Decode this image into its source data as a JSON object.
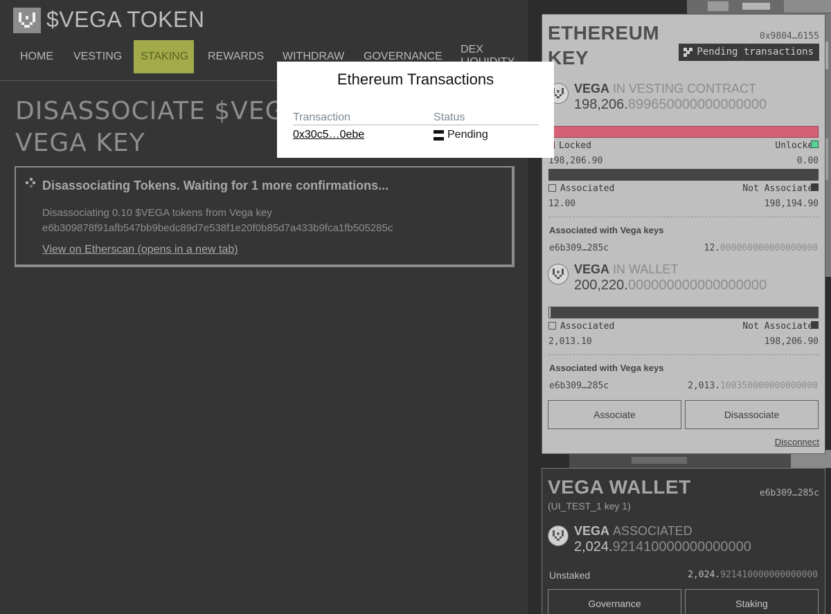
{
  "app": {
    "title": "$VEGA TOKEN",
    "nav": [
      "HOME",
      "VESTING",
      "STAKING",
      "REWARDS",
      "WITHDRAW",
      "GOVERNANCE",
      "DEX LIQUIDITY"
    ],
    "active_nav": "STAKING",
    "accent_color": "#a1ab4a"
  },
  "page": {
    "title_line1": "DISASSOCIATE $VEGA T",
    "title_line2": "VEGA KEY"
  },
  "callout": {
    "icon": "loader-icon",
    "heading": "Disassociating Tokens. Waiting for 1 more confirmations...",
    "text_line1": "Disassociating 0.10 $VEGA tokens from Vega key",
    "text_line2": "e6b309878f91afb547bb9bedc89d7e538f1e20f0b85d7a433b9fca1fb505285c",
    "link": "View on Etherscan (opens in a new tab)"
  },
  "modal": {
    "title": "Ethereum Transactions",
    "col_transaction": "Transaction",
    "col_status": "Status",
    "tx_hash": "0x30c5…0ebe",
    "status": "Pending"
  },
  "eth_card": {
    "title": "ETHEREUM KEY",
    "address": "0x9804…6155",
    "pending_button": "Pending transactions",
    "vesting": {
      "name": "VEGA",
      "label": "IN VESTING CONTRACT",
      "amount_int": "198,206.",
      "amount_frac": "899650000000000000",
      "locked_label": "Locked",
      "unlocked_label": "Unlocked",
      "locked_value": "198,206.90",
      "unlocked_value": "0.00",
      "locked_fraction": 1.0,
      "associated_label": "Associated",
      "not_associated_label": "Not Associated",
      "associated_value": "12.00",
      "not_associated_value": "198,194.90",
      "associated_fraction": 6e-05,
      "assoc_heading": "Associated with Vega keys",
      "assoc_key": "e6b309…285c",
      "assoc_amount_int": "12.",
      "assoc_amount_frac": "000060000000000000"
    },
    "wallet": {
      "name": "VEGA",
      "label": "IN WALLET",
      "amount_int": "200,220.",
      "amount_frac": "000000000000000000",
      "associated_label": "Associated",
      "not_associated_label": "Not Associated",
      "associated_value": "2,013.10",
      "not_associated_value": "198,206.90",
      "associated_fraction": 0.01,
      "assoc_heading": "Associated with Vega keys",
      "assoc_key": "e6b309…285c",
      "assoc_amount_int": "2,013.",
      "assoc_amount_frac": "100350000000000000"
    },
    "associate_button": "Associate",
    "disassociate_button": "Disassociate",
    "disconnect": "Disconnect",
    "locked_color": "#d66076",
    "unlocked_color": "#5ad099"
  },
  "wallet_card": {
    "title": "VEGA WALLET",
    "key": "e6b309…285c",
    "subtitle": "(UI_TEST_1 key 1)",
    "token_name": "VEGA",
    "token_label": "ASSOCIATED",
    "amount_int": "2,024.",
    "amount_frac": "921410000000000000",
    "unstaked_label": "Unstaked",
    "unstaked_int": "2,024.",
    "unstaked_frac": "921410000000000000",
    "governance_button": "Governance",
    "staking_button": "Staking"
  }
}
